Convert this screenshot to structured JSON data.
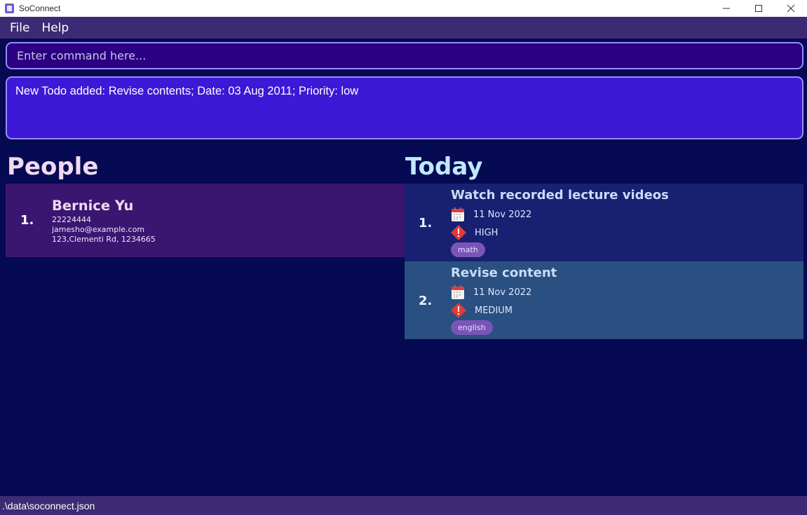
{
  "window": {
    "title": "SoConnect"
  },
  "menu": {
    "items": [
      "File",
      "Help"
    ]
  },
  "command": {
    "placeholder": "Enter command here...",
    "value": ""
  },
  "result": {
    "text": "New Todo added: Revise contents; Date: 03 Aug 2011; Priority: low"
  },
  "people": {
    "title": "People",
    "list": [
      {
        "index": "1.",
        "name": "Bernice Yu",
        "phone": "22224444",
        "email": "jamesho@example.com",
        "address": "123,Clementi Rd, 1234665"
      }
    ]
  },
  "today": {
    "title": "Today",
    "list": [
      {
        "index": "1.",
        "title": "Watch recorded lecture videos",
        "date": "11 Nov 2022",
        "priority": "HIGH",
        "tag": "math"
      },
      {
        "index": "2.",
        "title": "Revise content",
        "date": "11 Nov 2022",
        "priority": "MEDIUM",
        "tag": "english"
      }
    ]
  },
  "status": {
    "path": ".\\data\\soconnect.json"
  },
  "colors": {
    "background": "#050a52",
    "menubar": "#3c2b74",
    "command_bg": "#2b0082",
    "result_bg": "#3b19d6",
    "person_card": "#3a1671",
    "todo_1": "#172071",
    "todo_2": "#2a4f81",
    "tag": "#7955b8",
    "priority_icon": "#e53935"
  },
  "icons": {
    "calendar": "calendar-icon",
    "priority": "priority-warning-icon"
  }
}
